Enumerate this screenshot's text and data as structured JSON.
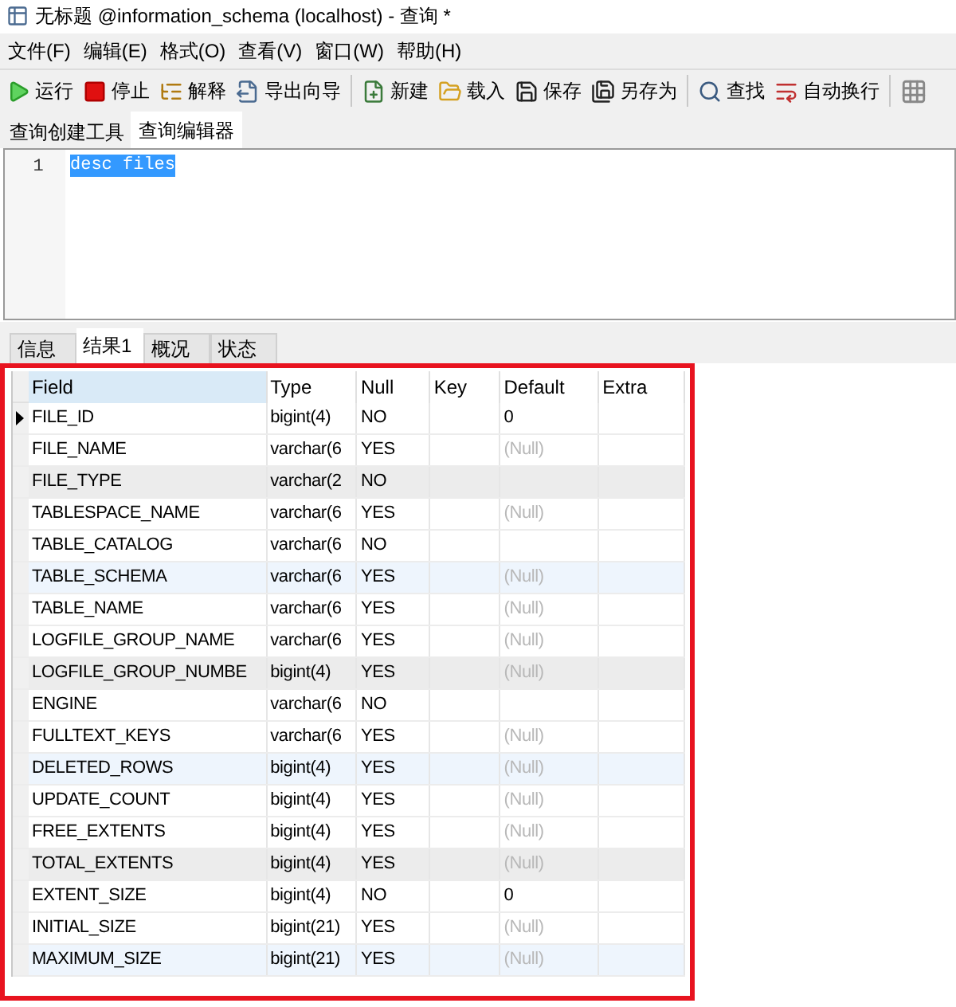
{
  "window": {
    "title": "无标题 @information_schema (localhost) - 查询 *"
  },
  "menu": [
    "文件(F)",
    "编辑(E)",
    "格式(O)",
    "查看(V)",
    "窗口(W)",
    "帮助(H)"
  ],
  "toolbar": [
    {
      "kind": "run",
      "label": "运行"
    },
    {
      "kind": "stop",
      "label": "停止"
    },
    {
      "kind": "explain",
      "label": "解释"
    },
    {
      "kind": "export",
      "label": "导出向导"
    },
    {
      "kind": "sep"
    },
    {
      "kind": "new",
      "label": "新建"
    },
    {
      "kind": "load",
      "label": "载入"
    },
    {
      "kind": "save",
      "label": "保存"
    },
    {
      "kind": "saveas",
      "label": "另存为"
    },
    {
      "kind": "sep"
    },
    {
      "kind": "find",
      "label": "查找"
    },
    {
      "kind": "wrap",
      "label": "自动换行"
    },
    {
      "kind": "sep"
    },
    {
      "kind": "grid"
    }
  ],
  "editor_tabs": [
    {
      "label": "查询创建工具",
      "selected": false
    },
    {
      "label": "查询编辑器",
      "selected": true
    }
  ],
  "editor": {
    "lines": [
      {
        "number": "1",
        "code": "desc files",
        "selected": true
      }
    ]
  },
  "result_tabs": [
    {
      "label": "信息",
      "selected": false
    },
    {
      "label": "结果1",
      "selected": true
    },
    {
      "label": "概况",
      "selected": false
    },
    {
      "label": "状态",
      "selected": false
    }
  ],
  "table": {
    "columns": [
      "Field",
      "Type",
      "Null",
      "Key",
      "Default",
      "Extra"
    ],
    "rows": [
      {
        "field": "FILE_ID",
        "type": "bigint(4)",
        "null": "NO",
        "default": "0",
        "default_is_null": false,
        "selected": true
      },
      {
        "field": "FILE_NAME",
        "type": "varchar(6",
        "null": "YES",
        "default": "(Null)",
        "default_is_null": true,
        "selected": false
      },
      {
        "field": "FILE_TYPE",
        "type": "varchar(2",
        "null": "NO",
        "selected": false,
        "color": "#ececec"
      },
      {
        "field": "TABLESPACE_NAME",
        "type": "varchar(6",
        "null": "YES",
        "default": "(Null)",
        "default_is_null": true,
        "selected": false
      },
      {
        "field": "TABLE_CATALOG",
        "type": "varchar(6",
        "null": "NO",
        "selected": false
      },
      {
        "field": "TABLE_SCHEMA",
        "type": "varchar(6",
        "null": "YES",
        "default": "(Null)",
        "default_is_null": true,
        "selected": false,
        "color": "#eef5fd"
      },
      {
        "field": "TABLE_NAME",
        "type": "varchar(6",
        "null": "YES",
        "default": "(Null)",
        "default_is_null": true,
        "selected": false
      },
      {
        "field": "LOGFILE_GROUP_NAME",
        "type": "varchar(6",
        "null": "YES",
        "default": "(Null)",
        "default_is_null": true,
        "selected": false
      },
      {
        "field": "LOGFILE_GROUP_NUMBE",
        "type": "bigint(4)",
        "null": "YES",
        "default": "(Null)",
        "default_is_null": true,
        "selected": false,
        "color": "#ececec"
      },
      {
        "field": "ENGINE",
        "type": "varchar(6",
        "null": "NO",
        "selected": false
      },
      {
        "field": "FULLTEXT_KEYS",
        "type": "varchar(6",
        "null": "YES",
        "default": "(Null)",
        "default_is_null": true,
        "selected": false
      },
      {
        "field": "DELETED_ROWS",
        "type": "bigint(4)",
        "null": "YES",
        "default": "(Null)",
        "default_is_null": true,
        "selected": false,
        "color": "#eef5fd"
      },
      {
        "field": "UPDATE_COUNT",
        "type": "bigint(4)",
        "null": "YES",
        "default": "(Null)",
        "default_is_null": true,
        "selected": false
      },
      {
        "field": "FREE_EXTENTS",
        "type": "bigint(4)",
        "null": "YES",
        "default": "(Null)",
        "default_is_null": true,
        "selected": false
      },
      {
        "field": "TOTAL_EXTENTS",
        "type": "bigint(4)",
        "null": "YES",
        "default": "(Null)",
        "default_is_null": true,
        "selected": false,
        "color": "#ececec"
      },
      {
        "field": "EXTENT_SIZE",
        "type": "bigint(4)",
        "null": "NO",
        "default": "0",
        "default_is_null": false,
        "selected": false
      },
      {
        "field": "INITIAL_SIZE",
        "type": "bigint(21)",
        "null": "YES",
        "default": "(Null)",
        "default_is_null": true,
        "selected": false
      },
      {
        "field": "MAXIMUM_SIZE",
        "type": "bigint(21)",
        "null": "YES",
        "default": "(Null)",
        "default_is_null": true,
        "selected": false,
        "color": "#eef5fd"
      }
    ]
  }
}
